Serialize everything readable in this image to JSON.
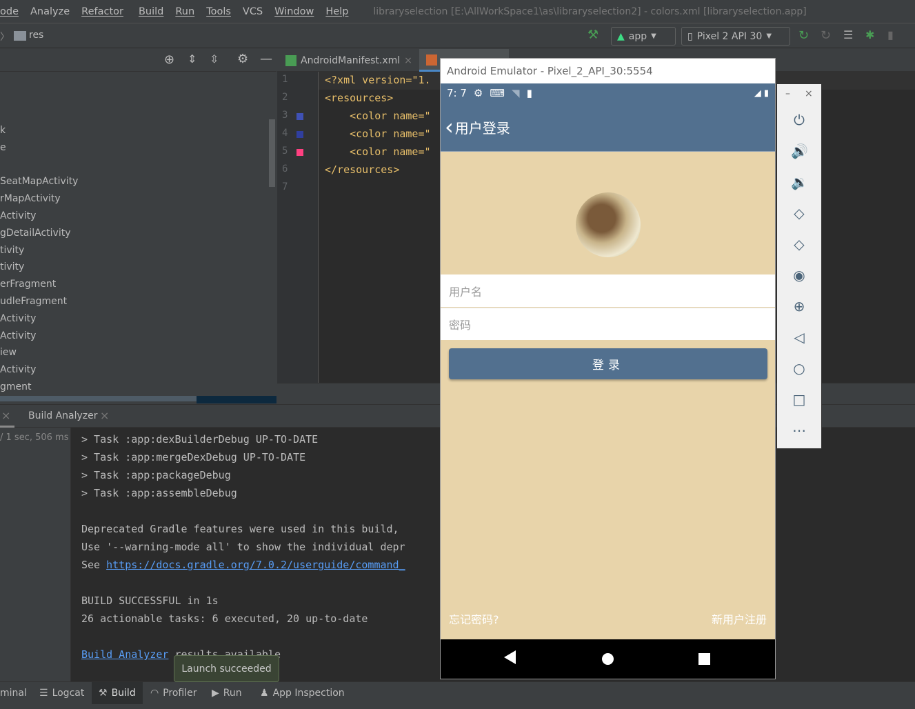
{
  "menu": {
    "items": [
      "ode",
      "Analyze",
      "Refactor",
      "Build",
      "Run",
      "Tools",
      "VCS",
      "Window",
      "Help"
    ],
    "title": "libraryselection [E:\\AllWorkSpace1\\as\\libraryselection2] - colors.xml [libraryselection.app]"
  },
  "toolbar": {
    "breadcrumb": "res",
    "config": "app",
    "device": "Pixel 2 API 30"
  },
  "project": {
    "items": [
      "k",
      "e",
      "SeatMapActivity",
      "rMapActivity",
      "Activity",
      "gDetailActivity",
      "tivity",
      "tivity",
      "erFragment",
      "udleFragment",
      "Activity",
      "Activity",
      "iew",
      "Activity",
      "gment"
    ]
  },
  "editor": {
    "tabs": [
      "AndroidManifest.xml"
    ],
    "lines": [
      {
        "n": "1",
        "text": "<?xml version=\"1."
      },
      {
        "n": "2",
        "text": "<resources>"
      },
      {
        "n": "3",
        "text": "    <color name=\"",
        "swatch": "#3f51b5"
      },
      {
        "n": "4",
        "text": "    <color name=\"",
        "swatch": "#303f9f"
      },
      {
        "n": "5",
        "text": "    <color name=\"",
        "swatch": "#ff4081"
      },
      {
        "n": "6",
        "text": "</resources>"
      },
      {
        "n": "7",
        "text": ""
      }
    ]
  },
  "bottom": {
    "tab": "Build Analyzer",
    "time": "/ 1 sec, 506 ms",
    "console": [
      "> Task :app:dexBuilderDebug UP-TO-DATE",
      "> Task :app:mergeDexDebug UP-TO-DATE",
      "> Task :app:packageDebug",
      "> Task :app:assembleDebug",
      "",
      "Deprecated Gradle features were used in this build,",
      "Use '--warning-mode all' to show the individual depr"
    ],
    "see": "See ",
    "link": "https://docs.gradle.org/7.0.2/userguide/command_",
    "success": "BUILD SUCCESSFUL in 1s",
    "tasks": "26 actionable tasks: 6 executed, 20 up-to-date",
    "analyzer_link": "Build Analyzer",
    "analyzer_rest": " results available"
  },
  "tooltip": "Launch succeeded",
  "tool_windows": [
    "minal",
    "Logcat",
    "Build",
    "Profiler",
    "Run",
    "App Inspection"
  ],
  "emulator": {
    "title": "Android Emulator - Pixel_2_API_30:5554",
    "time": "7: 7",
    "app_title": "用户登录",
    "username_placeholder": "用户名",
    "password_placeholder": "密码",
    "login": "登录",
    "forgot": "忘记密码?",
    "register": "新用户注册",
    "theme": "#52708f",
    "background": "#e8d4aa"
  }
}
